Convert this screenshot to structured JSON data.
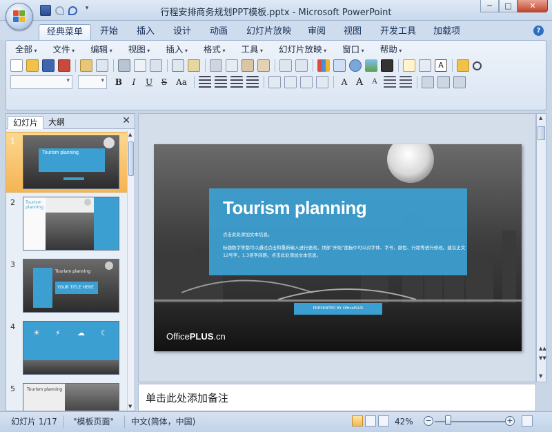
{
  "window": {
    "title": "行程安排商务规划PPT模板.pptx - Microsoft PowerPoint",
    "controls": {
      "minimize": "─",
      "maximize": "□",
      "close": "✕"
    }
  },
  "ribbon_tabs": [
    "经典菜单",
    "开始",
    "插入",
    "设计",
    "动画",
    "幻灯片放映",
    "审阅",
    "视图",
    "开发工具",
    "加载项"
  ],
  "active_tab": "经典菜单",
  "help": "?",
  "classic_menu": [
    "全部",
    "文件",
    "编辑",
    "视图",
    "插入",
    "格式",
    "工具",
    "幻灯片放映",
    "窗口",
    "帮助"
  ],
  "format_buttons": {
    "bold": "B",
    "italic": "I",
    "underline": "U",
    "strike": "S",
    "case": "Aa",
    "font_a": "A"
  },
  "slides_pane": {
    "tab_slides": "幻灯片",
    "tab_outline": "大纲",
    "close": "✕",
    "thumbnails": [
      {
        "num": "1",
        "title": "Tourism planning",
        "selected": true
      },
      {
        "num": "2",
        "title": "Tourism planning",
        "selected": false
      },
      {
        "num": "3",
        "title": "Tourism planning",
        "selected": false,
        "subtitle": "YOUR TITLE HERE"
      },
      {
        "num": "4",
        "title": "",
        "selected": false
      },
      {
        "num": "5",
        "title": "Tourism planning",
        "selected": false
      }
    ]
  },
  "slide": {
    "title": "Tourism planning",
    "line1": "点击此处添加文本信息。",
    "line2": "标题数字等都可以通过点击和重新输入进行更改，顶部“开始”面板中可以对字体、字号、颜色、行距等进行修改。建议正文12号字，1.3倍字间距。点击此处添加文本信息。",
    "button": "PRESENTED BY OfficePLUS",
    "brand_office": "Office",
    "brand_plus": "PLUS",
    "brand_cn": ".cn"
  },
  "notes_placeholder": "单击此处添加备注",
  "status": {
    "slide": "幻灯片 1/17",
    "theme": "\"模板页面\"",
    "language": "中文(简体，中国)",
    "zoom": "42%",
    "zoom_fraction": 0.42
  },
  "colors": {
    "accent_blue": "#3b9fd2",
    "ribbon_bg": "#dae5f3",
    "selection_orange": "#f5b453"
  }
}
